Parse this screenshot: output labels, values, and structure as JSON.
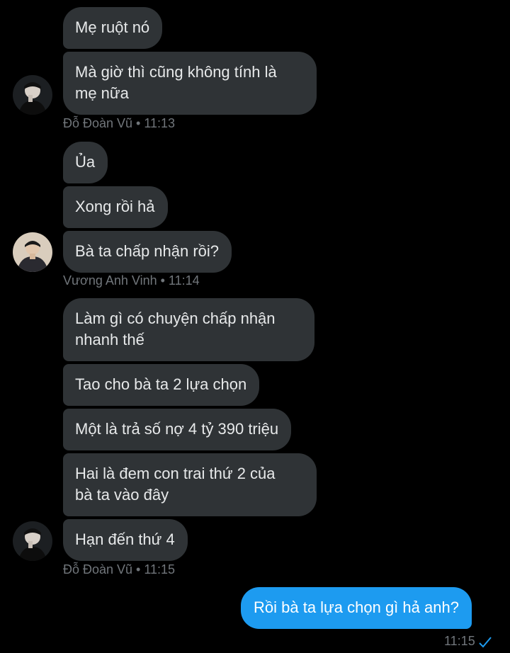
{
  "messages": {
    "g1": {
      "b1": "Mẹ ruột nó",
      "b2": "Mà giờ thì cũng không tính là\nmẹ nữa",
      "meta": "Đỗ Đoàn Vũ • 11:13"
    },
    "g2": {
      "b1": "Ủa",
      "b2": "Xong rồi hả",
      "b3": "Bà ta chấp nhận rồi?",
      "meta": "Vương Anh Vinh • 11:14"
    },
    "g3": {
      "b1": "Làm gì có chuyện chấp nhận\nnhanh thế",
      "b2": "Tao cho bà ta 2 lựa chọn",
      "b3": "Một là trả số nợ 4 tỷ 390 triệu",
      "b4": "Hai là đem con trai thứ 2 của\nbà ta vào đây",
      "b5": "Hạn đến thứ 4",
      "meta": "Đỗ Đoàn Vũ • 11:15"
    },
    "sent": {
      "text": "Rồi bà ta lựa chọn gì hả anh?",
      "time": "11:15"
    }
  },
  "icons": {
    "avatar1": "avatar",
    "avatar2": "avatar",
    "read": "checkmark-icon"
  },
  "colors": {
    "background": "#000000",
    "received_bubble": "#2f3336",
    "sent_bubble": "#1d9bf0",
    "meta_text": "#71767b"
  }
}
